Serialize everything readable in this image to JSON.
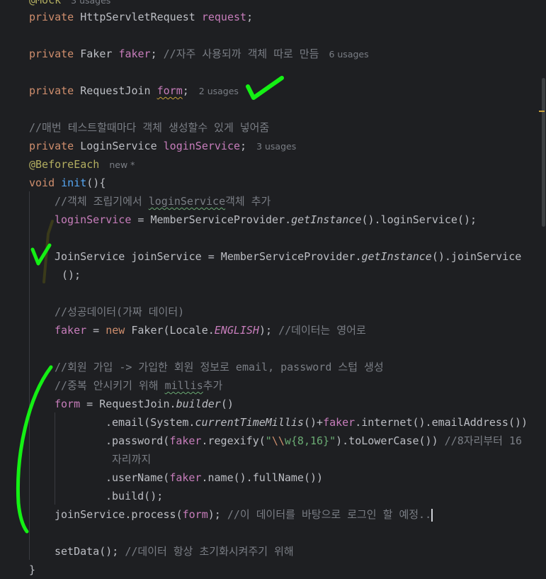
{
  "editor": {
    "lines": [
      {
        "anno": "@Mock",
        "usages": "3 usages"
      },
      {
        "kw": "private",
        "type": "HttpServletRequest",
        "field": "request",
        "end": ";"
      },
      {
        "kw": "private",
        "type": "Faker",
        "field": "faker",
        "end": ";",
        "comment": "//자주 사용되까 객체 따로 만듬",
        "usages": "6 usages"
      },
      {
        "kw": "private",
        "type": "RequestJoin",
        "field": "form",
        "end": ";",
        "usages": "2 usages"
      },
      {
        "comment": "//매번 테스트할때마다 객체 생성할수 있게 넣어줌"
      },
      {
        "kw": "private",
        "type": "LoginService",
        "field": "loginService",
        "end": ";",
        "usages": "3 usages"
      },
      {
        "anno": "@BeforeEach",
        "hint": "new *"
      },
      {
        "kw": "void",
        "fn": "init",
        "rest": "(){"
      },
      {
        "comment_pre": "//객체 조립기에서 ",
        "comment_squig": "loginService",
        "comment_post": "객체 추가"
      },
      {
        "field": "loginService",
        "mid": " = MemberServiceProvider.",
        "call": "getInstance",
        "rest": "().loginService();"
      },
      {
        "pre": "JoinService joinService = MemberServiceProvider.",
        "call": "getInstance",
        "rest": "().joinService"
      },
      {
        "rest": "();"
      },
      {
        "comment": "//성공데이터(가짜 데이터)"
      },
      {
        "field": "faker",
        "mid": " = ",
        "kw": "new",
        "pre2": " Faker(Locale.",
        "const": "ENGLISH",
        "rest": ");",
        "comment": "//데이터는 영어로"
      },
      {
        "comment": "//회원 가입 -> 가입한 회원 정보로 email, password 스텁 생성"
      },
      {
        "comment_pre": "//중복 안시키기 위해 ",
        "comment_squig": "millis",
        "comment_post": "추가"
      },
      {
        "field": "form",
        "mid": " = RequestJoin.",
        "call": "builder",
        "rest": "()"
      },
      {
        "pre": ".email(System.",
        "call": "currentTimeMillis",
        "mid": "()+",
        "field": "faker",
        "rest": ".internet().emailAddress())"
      },
      {
        "pre": ".password(",
        "field": "faker",
        "mid": ".regexify(",
        "str_q": "\"",
        "esc": "\\\\",
        "str": "w{8,16}",
        "str_q2": "\"",
        "rest": ").toLowerCase())",
        "comment": "//8자리부터 16"
      },
      {
        "comment": "자리까지"
      },
      {
        "pre": ".userName(",
        "field": "faker",
        "rest": ".name().fullName())"
      },
      {
        "rest": ".build();"
      },
      {
        "pre": "joinService.process(",
        "field": "form",
        "rest": ");",
        "comment": "//이 데이터를 바탕으로 로그인 할 예정.."
      },
      {
        "pre": "setData();",
        "comment": "//데이터 항상 초기화시켜주기 위해"
      },
      {
        "rest": "}"
      }
    ]
  },
  "colors": {
    "background": "#1e1f22",
    "keyword": "#cf8e6d",
    "field": "#c77dbb",
    "comment": "#7a7e85",
    "annotation": "#b3ae60",
    "function": "#56a8f5",
    "string": "#6aab73",
    "marker_green": "#14f014"
  }
}
